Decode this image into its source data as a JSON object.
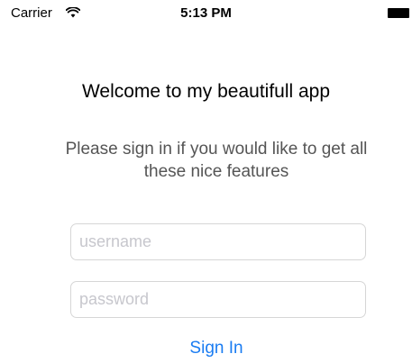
{
  "status_bar": {
    "carrier": "Carrier",
    "time": "5:13 PM",
    "wifi_icon": "wifi-icon",
    "battery_icon": "battery-icon"
  },
  "main": {
    "welcome": "Welcome to my beautifull app",
    "subtitle": "Please sign in if you would like to get all these nice features",
    "username": {
      "value": "",
      "placeholder": "username"
    },
    "password": {
      "value": "",
      "placeholder": "password"
    },
    "sign_in_label": "Sign In"
  },
  "colors": {
    "accent": "#1a7cf2",
    "subtitle_text": "#555555",
    "placeholder_text": "#c7c7cd",
    "field_border": "#d6d6d6"
  }
}
